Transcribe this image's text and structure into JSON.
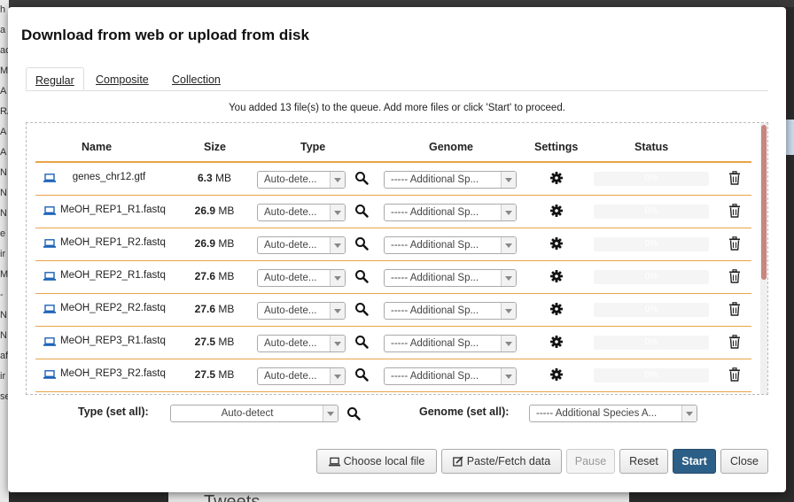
{
  "dialog": {
    "title": "Download from web or upload from disk",
    "tabs": [
      {
        "label": "Regular",
        "active": true
      },
      {
        "label": "Composite",
        "active": false
      },
      {
        "label": "Collection",
        "active": false
      }
    ],
    "message": "You added 13 file(s) to the queue. Add more files or click 'Start' to proceed."
  },
  "table": {
    "headers": {
      "name": "Name",
      "size": "Size",
      "type": "Type",
      "genome": "Genome",
      "settings": "Settings",
      "status": "Status"
    },
    "rows": [
      {
        "name": "genes_chr12.gtf",
        "size_value": "6.3",
        "size_unit": "MB",
        "type": "Auto-dete...",
        "genome": "----- Additional Sp...",
        "progress": "0%"
      },
      {
        "name": "MeOH_REP1_R1.fastq",
        "size_value": "26.9",
        "size_unit": "MB",
        "type": "Auto-dete...",
        "genome": "----- Additional Sp...",
        "progress": "0%"
      },
      {
        "name": "MeOH_REP1_R2.fastq",
        "size_value": "26.9",
        "size_unit": "MB",
        "type": "Auto-dete...",
        "genome": "----- Additional Sp...",
        "progress": "0%"
      },
      {
        "name": "MeOH_REP2_R1.fastq",
        "size_value": "27.6",
        "size_unit": "MB",
        "type": "Auto-dete...",
        "genome": "----- Additional Sp...",
        "progress": "0%"
      },
      {
        "name": "MeOH_REP2_R2.fastq",
        "size_value": "27.6",
        "size_unit": "MB",
        "type": "Auto-dete...",
        "genome": "----- Additional Sp...",
        "progress": "0%"
      },
      {
        "name": "MeOH_REP3_R1.fastq",
        "size_value": "27.5",
        "size_unit": "MB",
        "type": "Auto-dete...",
        "genome": "----- Additional Sp...",
        "progress": "0%"
      },
      {
        "name": "MeOH_REP3_R2.fastq",
        "size_value": "27.5",
        "size_unit": "MB",
        "type": "Auto-dete...",
        "genome": "----- Additional Sp...",
        "progress": "0%"
      }
    ]
  },
  "set_all": {
    "type_label": "Type (set all):",
    "type_value": "Auto-detect",
    "genome_label": "Genome (set all):",
    "genome_value": "----- Additional Species A..."
  },
  "buttons": {
    "choose_local": "Choose local file",
    "paste_fetch": "Paste/Fetch data",
    "pause": "Pause",
    "reset": "Reset",
    "start": "Start",
    "close": "Close"
  },
  "background": {
    "left_fragments": [
      "h",
      "a",
      "ac",
      "M",
      "A",
      "RA",
      "A",
      "A",
      "NI",
      "NI",
      "NI",
      "e",
      "ir",
      "M",
      "-M",
      "NI",
      "NI",
      "af",
      "ir",
      "se"
    ],
    "bottom_text": "Tweets"
  },
  "colors": {
    "accent_line": "#e8a548",
    "primary_button": "#2c5f87",
    "file_icon": "#1d63b8",
    "scroll_thumb": "#c9867e"
  },
  "icons": {
    "file": "laptop-icon",
    "preview": "search-icon",
    "settings": "gear-icon",
    "remove": "trash-icon"
  }
}
